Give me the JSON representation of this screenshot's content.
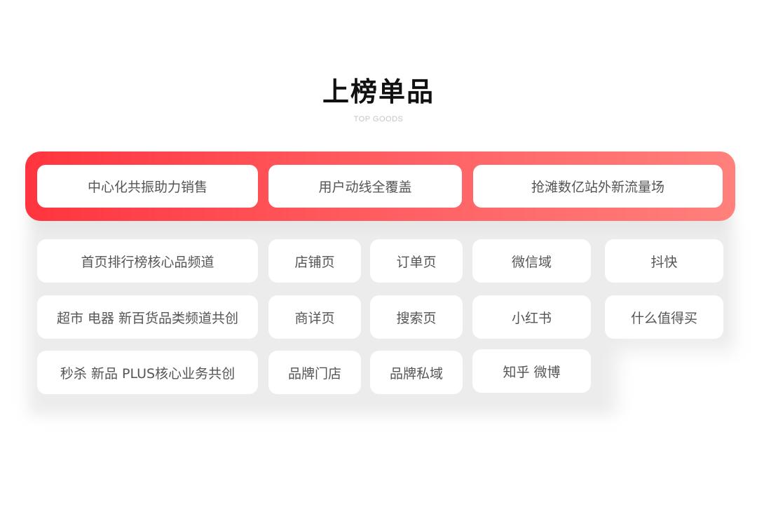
{
  "header": {
    "title": "上榜单品",
    "subtitle": "TOP GOODS"
  },
  "colors": {
    "gradient_start": "#ff343e",
    "gradient_end": "#ff807c",
    "card_background": "#ffffff",
    "panel_background": "#ececec",
    "text": "#555555"
  },
  "highlight_items": [
    {
      "label": "中心化共振助力销售"
    },
    {
      "label": "用户动线全覆盖"
    },
    {
      "label": "抢滩数亿站外新流量场"
    }
  ],
  "grid": {
    "rows": [
      [
        "首页排行榜核心品频道",
        "店铺页",
        "订单页",
        "微信域",
        "抖快"
      ],
      [
        "超市 电器 新百货品类频道共创",
        "商详页",
        "搜索页",
        "小红书",
        "什么值得买"
      ],
      [
        "秒杀 新品 PLUS核心业务共创",
        "品牌门店",
        "品牌私域",
        "知乎 微博"
      ]
    ]
  }
}
